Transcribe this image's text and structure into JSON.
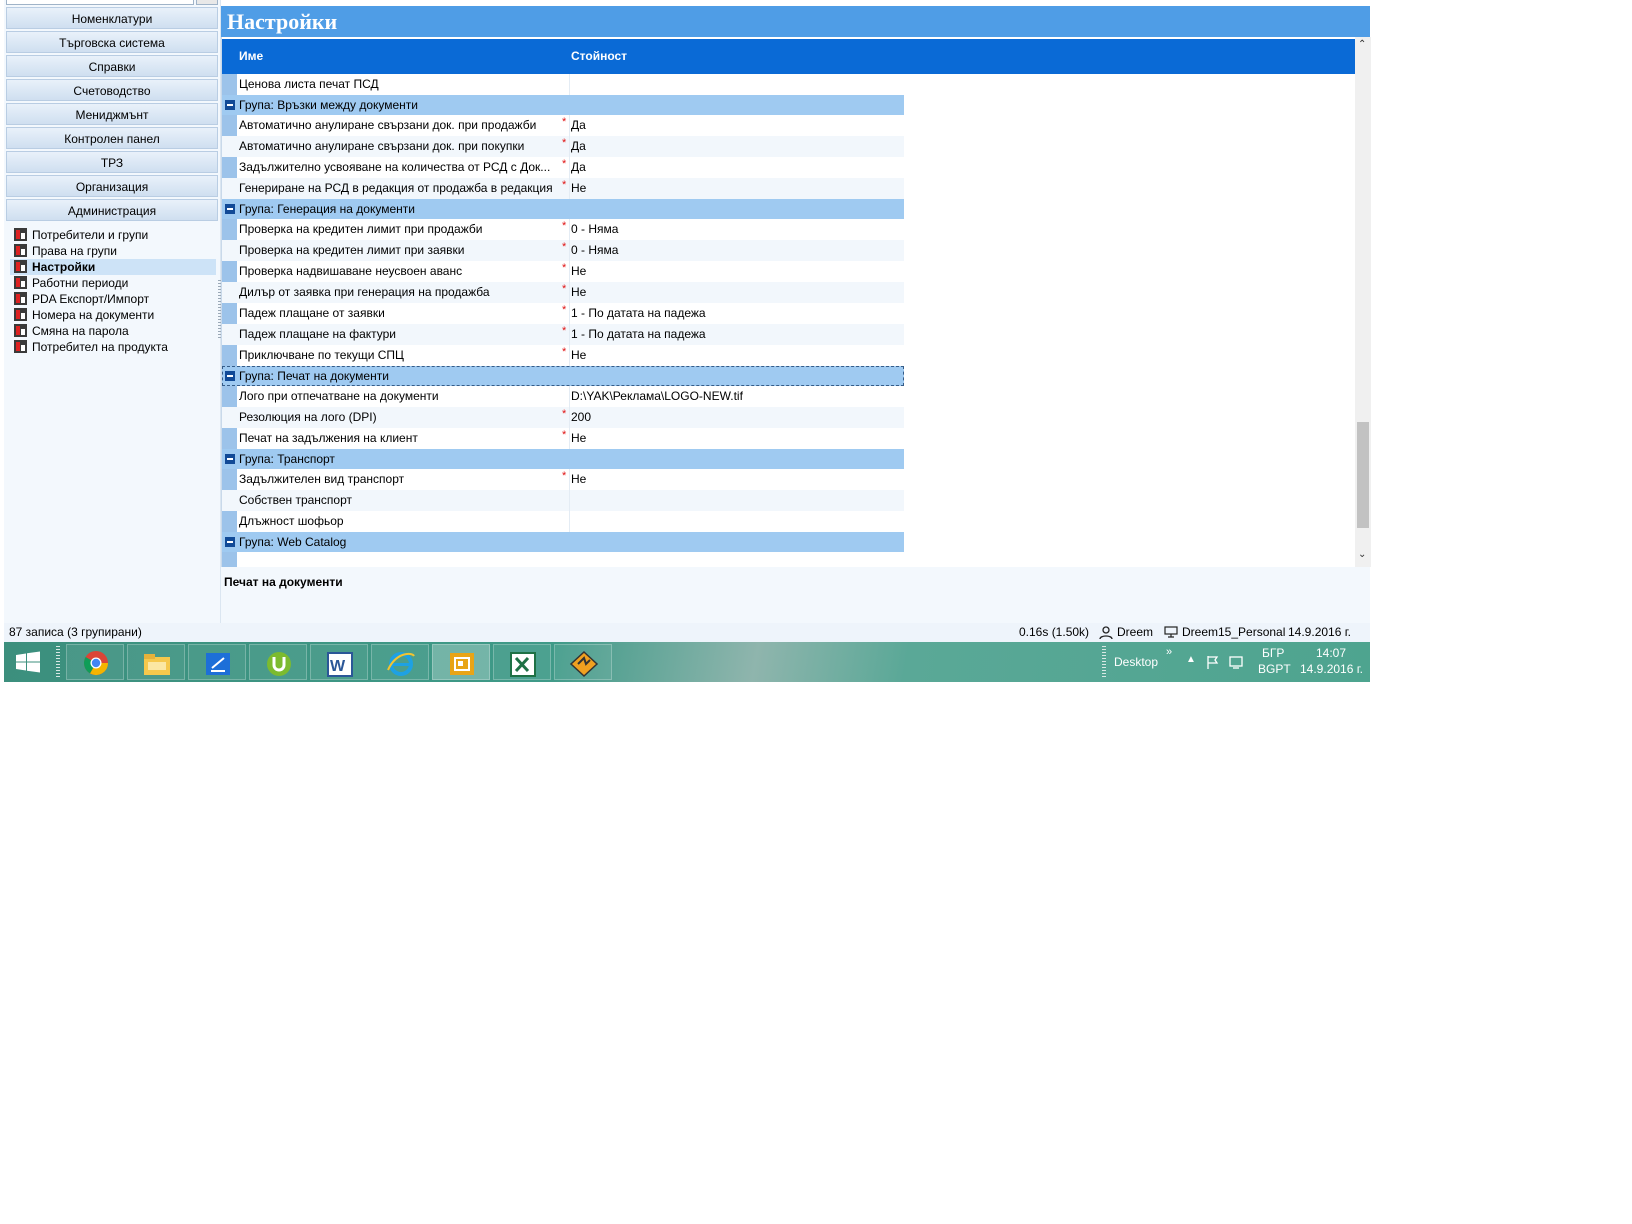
{
  "sidebar": {
    "modules": [
      "Номенклатури",
      "Търговска система",
      "Справки",
      "Счетоводство",
      "Мениджмънт",
      "Контролен панел",
      "ТРЗ",
      "Организация",
      "Администрация"
    ],
    "items": [
      {
        "label": "Потребители и групи",
        "active": false
      },
      {
        "label": "Права на групи",
        "active": false
      },
      {
        "label": "Настройки",
        "active": true
      },
      {
        "label": "Работни периоди",
        "active": false
      },
      {
        "label": "PDA Експорт/Импорт",
        "active": false
      },
      {
        "label": "Номера на документи",
        "active": false
      },
      {
        "label": "Смяна на парола",
        "active": false
      },
      {
        "label": "Потребител на продукта",
        "active": false
      }
    ]
  },
  "main": {
    "title": "Настройки",
    "columns": {
      "name": "Име",
      "value": "Стойност"
    },
    "rows": [
      {
        "type": "row",
        "name": "Ценова листа печат ПСД",
        "required": false,
        "value": ""
      },
      {
        "type": "group",
        "name": "Група: Връзки между документи"
      },
      {
        "type": "row",
        "name": "Автоматично анулиране свързани док. при продажби",
        "required": true,
        "value": "Да"
      },
      {
        "type": "row",
        "name": "Автоматично анулиране свързани док. при покупки",
        "required": true,
        "value": "Да"
      },
      {
        "type": "row",
        "name": "Задължително усвояване на количества от РСД с Док...",
        "required": true,
        "value": "Да"
      },
      {
        "type": "row",
        "name": "Генериране на РСД в редакция от продажба в редакция",
        "required": true,
        "value": "Не"
      },
      {
        "type": "group",
        "name": "Група: Генерация на документи"
      },
      {
        "type": "row",
        "name": "Проверка на кредитен лимит при продажби",
        "required": true,
        "value": "0 - Няма"
      },
      {
        "type": "row",
        "name": "Проверка на кредитен лимит при заявки",
        "required": true,
        "value": "0 - Няма"
      },
      {
        "type": "row",
        "name": "Проверка надвишаване неусвоен аванс",
        "required": true,
        "value": "Не"
      },
      {
        "type": "row",
        "name": "Дилър от заявка при генерация на продажба",
        "required": true,
        "value": "Не"
      },
      {
        "type": "row",
        "name": "Падеж плащане от заявки",
        "required": true,
        "value": "1 - По датата на падежа"
      },
      {
        "type": "row",
        "name": "Падеж плащане на фактури",
        "required": true,
        "value": "1 - По датата на падежа"
      },
      {
        "type": "row",
        "name": "Приключване по текущи СПЦ",
        "required": true,
        "value": "Не"
      },
      {
        "type": "group",
        "name": "Група: Печат на документи",
        "selected": true
      },
      {
        "type": "row",
        "name": "Лого при отпечатване на документи",
        "required": false,
        "value": "D:\\YAK\\Реклама\\LOGO-NEW.tif"
      },
      {
        "type": "row",
        "name": "Резолюция на лого (DPI)",
        "required": true,
        "value": "200"
      },
      {
        "type": "row",
        "name": "Печат на задължения на клиент",
        "required": true,
        "value": "Не"
      },
      {
        "type": "group",
        "name": "Група: Транспорт"
      },
      {
        "type": "row",
        "name": "Задължителен вид транспорт",
        "required": true,
        "value": "Не"
      },
      {
        "type": "row",
        "name": "Собствен транспорт",
        "required": false,
        "value": ""
      },
      {
        "type": "row",
        "name": "Длъжност шофьор",
        "required": false,
        "value": ""
      },
      {
        "type": "group",
        "name": "Група: Web Catalog"
      }
    ],
    "description": "Печат на документи"
  },
  "status": {
    "records": "87 записа (3 групирани)",
    "timing": "0.16s (1.50k)",
    "user": "Dreem",
    "database": "Dreem15_Personal",
    "date": "14.9.2016 г."
  },
  "taskbar": {
    "apps": [
      "chrome-icon",
      "file-explorer-icon",
      "scanner-icon",
      "utorrent-icon",
      "word-icon",
      "internet-explorer-icon",
      "presentation-icon",
      "excel-icon",
      "winamp-icon"
    ],
    "active_app": "presentation-icon",
    "tray": {
      "desktop": "Desktop",
      "chevron": "»",
      "lang": "БГР",
      "layout": "BGPT",
      "time": "14:07",
      "date": "14.9.2016 г."
    }
  },
  "colors": {
    "header_blue": "#0a6ad6",
    "title_blue": "#4f9de6",
    "group_blue": "#9fcaf1",
    "required": "#e01010"
  }
}
